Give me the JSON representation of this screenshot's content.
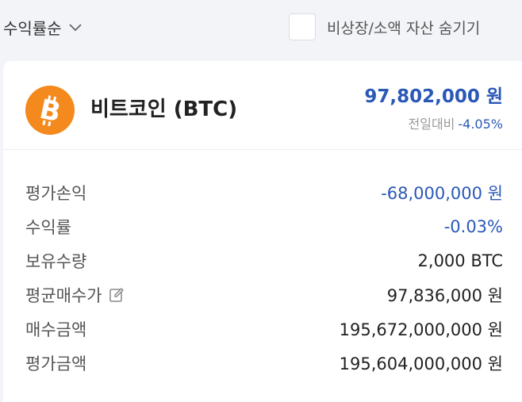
{
  "header": {
    "sort_label": "수익률순",
    "hide_small_label": "비상장/소액 자산 숨기기"
  },
  "coin": {
    "name": "비트코인 (BTC)",
    "price": "97,802,000 원",
    "change_label": "전일대비",
    "change_pct": "-4.05%",
    "logo_color": "#f4891d"
  },
  "rows": [
    {
      "label": "평가손익",
      "value": "-68,000,000 원"
    },
    {
      "label": "수익률",
      "value": "-0.03%"
    },
    {
      "label": "보유수량",
      "value": "2,000 BTC"
    },
    {
      "label": "평균매수가",
      "value": "97,836,000 원"
    },
    {
      "label": "매수금액",
      "value": "195,672,000,000 원"
    },
    {
      "label": "평가금액",
      "value": "195,604,000,000 원"
    }
  ],
  "colors": {
    "accent_blue": "#2a58b6",
    "background": "#f3f4f8"
  }
}
